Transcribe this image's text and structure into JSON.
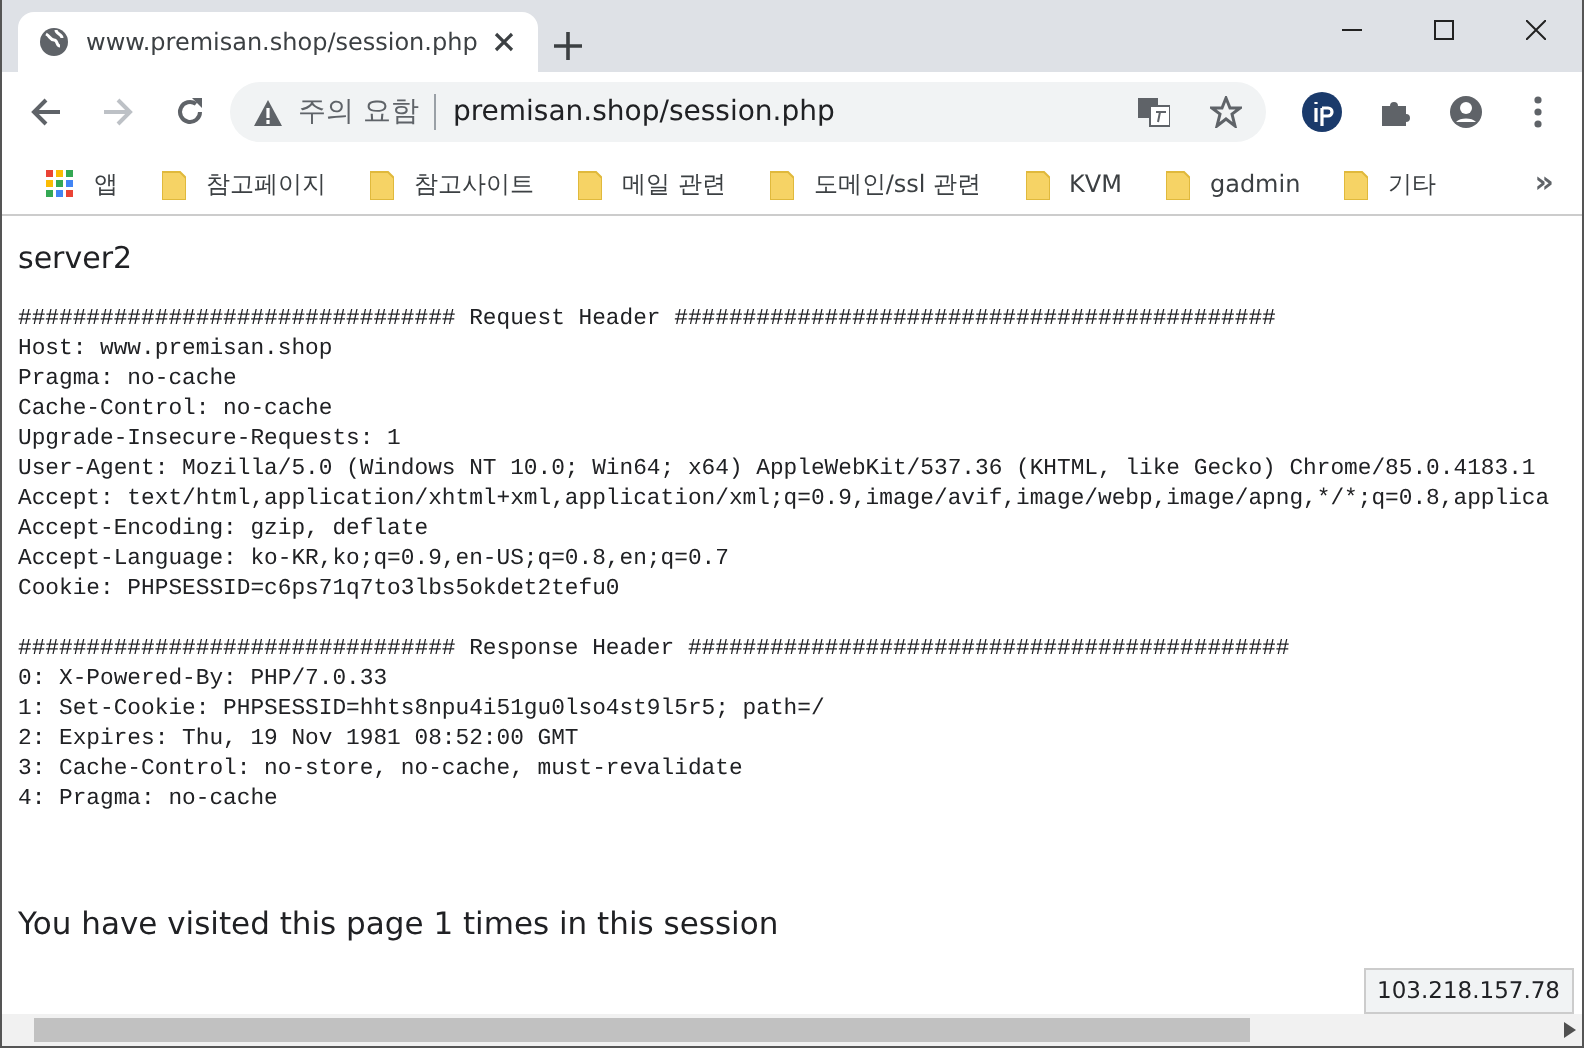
{
  "tabs": [
    {
      "title": "www.premisan.shop/session.php",
      "selected": true
    }
  ],
  "address_bar": {
    "security_label": "주의 요함",
    "url": "premisan.shop/session.php"
  },
  "bookmarks": [
    {
      "kind": "apps",
      "label": "앱"
    },
    {
      "kind": "folder",
      "label": "참고페이지"
    },
    {
      "kind": "folder",
      "label": "참고사이트"
    },
    {
      "kind": "folder",
      "label": "메일 관련"
    },
    {
      "kind": "folder",
      "label": "도메인/ssl 관련"
    },
    {
      "kind": "folder",
      "label": "KVM"
    },
    {
      "kind": "folder",
      "label": "gadmin"
    },
    {
      "kind": "folder",
      "label": "기타"
    }
  ],
  "bookmarks_overflow": "»",
  "page": {
    "heading": "server2",
    "blocks": [
      {
        "title": "################################ Request Header ############################################",
        "lines": [
          "Host: www.premisan.shop",
          "Pragma: no-cache",
          "Cache-Control: no-cache",
          "Upgrade-Insecure-Requests: 1",
          "User-Agent: Mozilla/5.0 (Windows NT 10.0; Win64; x64) AppleWebKit/537.36 (KHTML, like Gecko) Chrome/85.0.4183.1",
          "Accept: text/html,application/xhtml+xml,application/xml;q=0.9,image/avif,image/webp,image/apng,*/*;q=0.8,applica",
          "Accept-Encoding: gzip, deflate",
          "Accept-Language: ko-KR,ko;q=0.9,en-US;q=0.8,en;q=0.7",
          "Cookie: PHPSESSID=c6ps71q7to3lbs5okdet2tefu0"
        ]
      },
      {
        "title": "################################ Response Header ############################################",
        "lines": [
          "0: X-Powered-By: PHP/7.0.33",
          "1: Set-Cookie: PHPSESSID=hhts8npu4i51gu0lso4st9l5r5; path=/",
          "2: Expires: Thu, 19 Nov 1981 08:52:00 GMT",
          "3: Cache-Control: no-store, no-cache, must-revalidate",
          "4: Pragma: no-cache"
        ]
      }
    ],
    "footer": "You have visited this page 1 times in this session"
  },
  "status_bubble": "103.218.157.78"
}
